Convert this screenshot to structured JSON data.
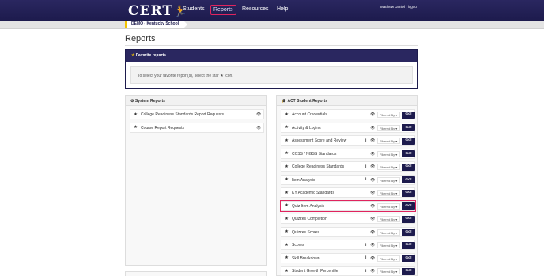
{
  "nav": {
    "logo": "CERT",
    "items": [
      {
        "label": "Students",
        "active": false
      },
      {
        "label": "Reports",
        "active": true
      },
      {
        "label": "Resources",
        "active": false
      },
      {
        "label": "Help",
        "active": false
      }
    ],
    "user": "Matthew Daniel | logout"
  },
  "school": "DEMO - Kentucky School",
  "page_title": "Reports",
  "favorites": {
    "title": "Favorite reports",
    "message": "To select your favorite report(s), select the star ★ icon."
  },
  "system_reports": {
    "title": "System Reports",
    "items": [
      {
        "label": "College Readiness Standards Report Requests"
      },
      {
        "label": "Course Report Requests"
      }
    ]
  },
  "act_reports": {
    "title": "ACT Student Reports",
    "filter_label": "Filtered By",
    "go_label": "Go!",
    "items": [
      {
        "label": "Account Credentials",
        "info": false,
        "highlight": false
      },
      {
        "label": "Activity & Logins",
        "info": false,
        "highlight": false
      },
      {
        "label": "Assessment Score and Review",
        "info": true,
        "highlight": false
      },
      {
        "label": "CCSS / NGSS Standards",
        "info": false,
        "highlight": false
      },
      {
        "label": "College Readiness Standards",
        "info": true,
        "highlight": false
      },
      {
        "label": "Item Analysis",
        "info": true,
        "highlight": false
      },
      {
        "label": "KY Academic Standards",
        "info": false,
        "highlight": false
      },
      {
        "label": "Quiz Item Analysis",
        "info": false,
        "highlight": true
      },
      {
        "label": "Quizzes Completion",
        "info": false,
        "highlight": false
      },
      {
        "label": "Quizzes Scores",
        "info": false,
        "highlight": false
      },
      {
        "label": "Scores",
        "info": true,
        "highlight": false
      },
      {
        "label": "Skill Breakdown",
        "info": true,
        "highlight": false
      },
      {
        "label": "Student Growth Percentile",
        "info": true,
        "highlight": false
      }
    ]
  },
  "colors": {
    "nav_bg": "#2a2760",
    "accent": "#e0245e",
    "go_button": "#1d1b4d",
    "school_accent": "#f2c300"
  }
}
